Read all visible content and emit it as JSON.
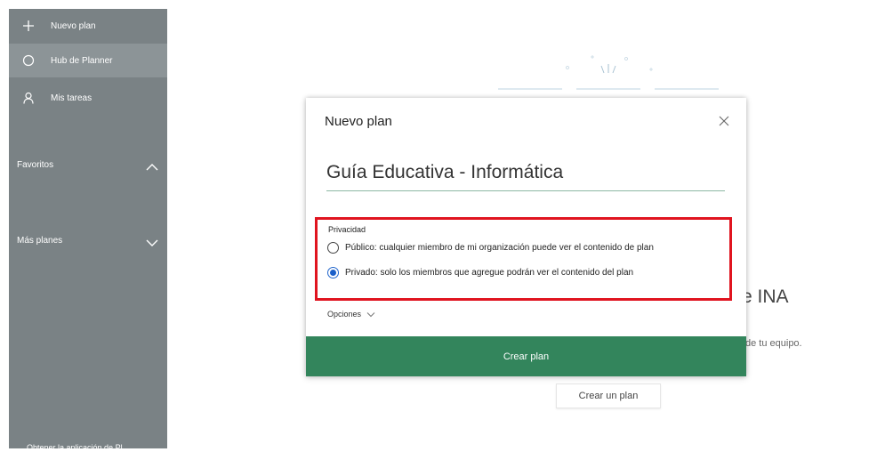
{
  "sidebar": {
    "items": [
      {
        "label": "Nuevo plan",
        "icon": "plus-icon"
      },
      {
        "label": "Hub de Planner",
        "icon": "circle-icon"
      },
      {
        "label": "Mis tareas",
        "icon": "person-icon"
      }
    ],
    "sections": [
      {
        "label": "Favoritos",
        "icon": "chevron-up-icon"
      },
      {
        "label": "Más planes",
        "icon": "chevron-down-icon"
      }
    ],
    "footer": "Obtener la aplicación de Pl..."
  },
  "background": {
    "title_fragment": "e INA",
    "subtitle_fragment": "de tu equipo.",
    "create_button": "Crear un plan"
  },
  "dialog": {
    "title": "Nuevo plan",
    "plan_name": "Guía Educativa - Informática",
    "privacy": {
      "label": "Privacidad",
      "options": [
        {
          "label": "Público: cualquier miembro de mi organización puede ver el contenido de plan",
          "selected": false
        },
        {
          "label": "Privado: solo los miembros que agregue podrán ver el contenido del plan",
          "selected": true
        }
      ]
    },
    "options_label": "Opciones",
    "create_button": "Crear plan"
  },
  "colors": {
    "sidebar": "#7a8285",
    "sidebar_active": "#8c9497",
    "create_button": "#33855c",
    "highlight_box": "#e0141f",
    "radio_selected": "#1a5fc9"
  }
}
